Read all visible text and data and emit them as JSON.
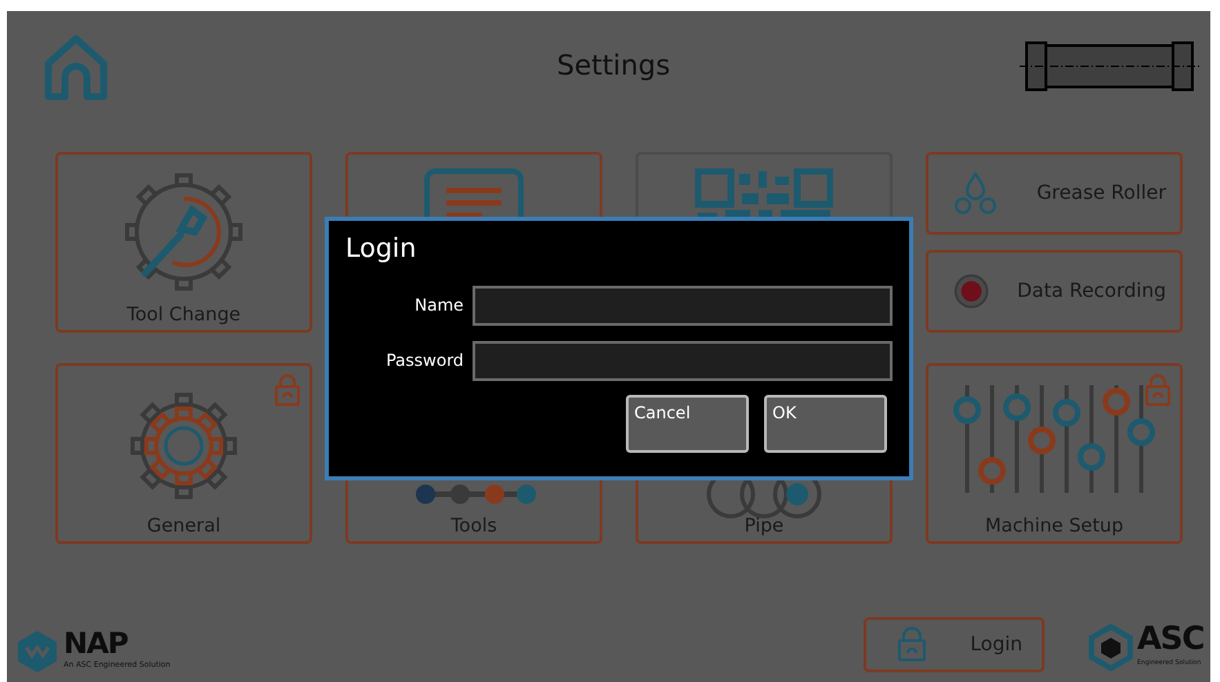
{
  "header": {
    "title": "Settings"
  },
  "tiles": [
    {
      "kind": "tool_change",
      "label": "Tool Change",
      "locked": false
    },
    {
      "kind": "document",
      "locked": false
    },
    {
      "kind": "qr",
      "locked": false
    },
    {
      "kind": "grease",
      "label": "Grease Roller",
      "locked": false
    },
    {
      "kind": "record",
      "label": "Data Recording",
      "locked": false
    },
    {
      "kind": "general",
      "label": "General",
      "locked": true
    },
    {
      "kind": "tools",
      "label": "Tools",
      "locked": false
    },
    {
      "kind": "pipe",
      "label": "Pipe",
      "locked": false
    },
    {
      "kind": "machine",
      "label": "Machine Setup",
      "locked": true
    }
  ],
  "footer": {
    "brand_left": {
      "name": "NAP",
      "tagline": "An ASC Engineered Solution"
    },
    "login_button": "Login",
    "brand_right": {
      "name": "ASC",
      "tagline": "Engineered Solution"
    }
  },
  "dialog": {
    "title": "Login",
    "fields": [
      {
        "label": "Name"
      },
      {
        "label": "Password"
      }
    ],
    "buttons": [
      "Cancel",
      "OK"
    ]
  }
}
